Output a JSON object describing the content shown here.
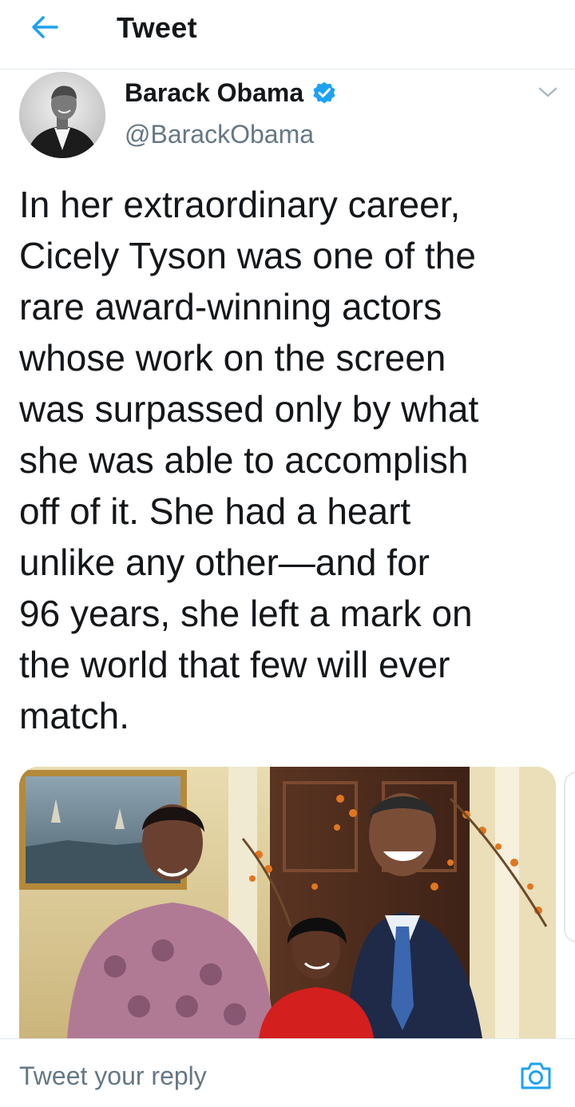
{
  "header": {
    "title": "Tweet",
    "back_icon": "arrow-left-icon"
  },
  "author": {
    "name": "Barack Obama",
    "handle": "@BarackObama",
    "verified": true,
    "verified_icon": "verified-badge-icon"
  },
  "tweet": {
    "text": "In her extraordinary career,\nCicely Tyson was one of the\nrare award-winning actors\nwhose work on the screen\nwas surpassed only by what\nshe was able to accomplish\noff of it. She had a heart\nunlike any other—and for\n96 years, she left a mark on\nthe world that few will ever\nmatch."
  },
  "reply": {
    "placeholder": "Tweet your reply",
    "camera_icon": "camera-icon"
  },
  "colors": {
    "accent": "#1da1f2",
    "text_primary": "#14171a",
    "text_secondary": "#657786",
    "divider": "#e1e8ed"
  }
}
